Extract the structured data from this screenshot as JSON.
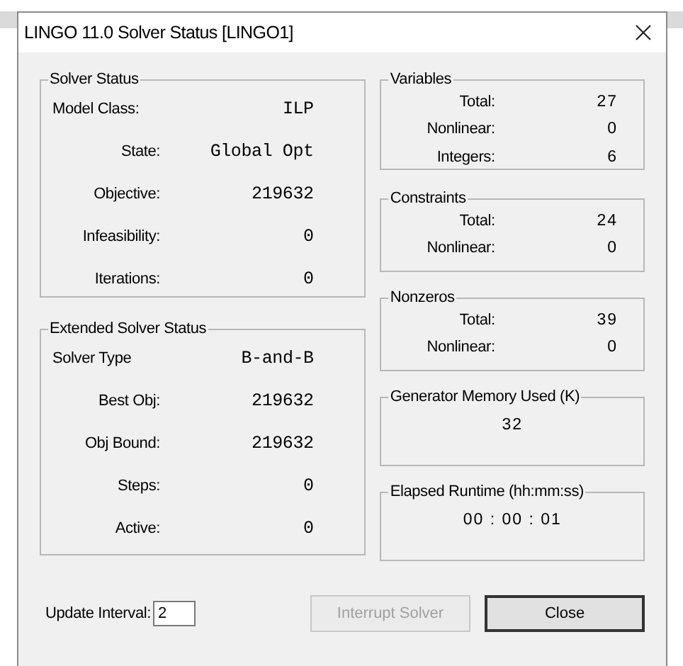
{
  "window": {
    "title": "LINGO 11.0 Solver Status [LINGO1]"
  },
  "left_groups": [
    {
      "title": "Solver Status",
      "kind": "wide-rows",
      "rows": [
        {
          "label": "Model Class:",
          "value": "ILP"
        },
        {
          "label": "State:",
          "value": "Global Opt"
        },
        {
          "label": "Objective:",
          "value": "219632"
        },
        {
          "label": "Infeasibility:",
          "value": "0"
        },
        {
          "label": "Iterations:",
          "value": "0"
        }
      ]
    },
    {
      "title": "Extended Solver Status",
      "kind": "wide-rows",
      "rows": [
        {
          "label": "Solver Type",
          "value": "B-and-B"
        },
        {
          "label": "Best Obj:",
          "value": "219632"
        },
        {
          "label": "Obj Bound:",
          "value": "219632"
        },
        {
          "label": "Steps:",
          "value": "0"
        },
        {
          "label": "Active:",
          "value": "0"
        }
      ]
    }
  ],
  "right_groups": [
    {
      "title": "Variables",
      "kind": "compact-rows",
      "rows": [
        {
          "label": "Total:",
          "value": "27"
        },
        {
          "label": "Nonlinear:",
          "value": "0"
        },
        {
          "label": "Integers:",
          "value": "6"
        }
      ]
    },
    {
      "title": "Constraints",
      "kind": "compact-rows",
      "rows": [
        {
          "label": "Total:",
          "value": "24"
        },
        {
          "label": "Nonlinear:",
          "value": "0"
        }
      ]
    },
    {
      "title": "Nonzeros",
      "kind": "compact-rows",
      "rows": [
        {
          "label": "Total:",
          "value": "39"
        },
        {
          "label": "Nonlinear:",
          "value": "0"
        }
      ]
    },
    {
      "title": "Generator Memory Used (K)",
      "kind": "single",
      "value": "32"
    },
    {
      "title": "Elapsed Runtime (hh:mm:ss)",
      "kind": "single",
      "value": "00 : 00 : 01"
    }
  ],
  "update_interval": {
    "label": "Update Interval:",
    "value": "2"
  },
  "buttons": [
    {
      "label": "Interrupt Solver",
      "disabled": true,
      "default": false
    },
    {
      "label": "Close",
      "disabled": false,
      "default": true
    }
  ]
}
